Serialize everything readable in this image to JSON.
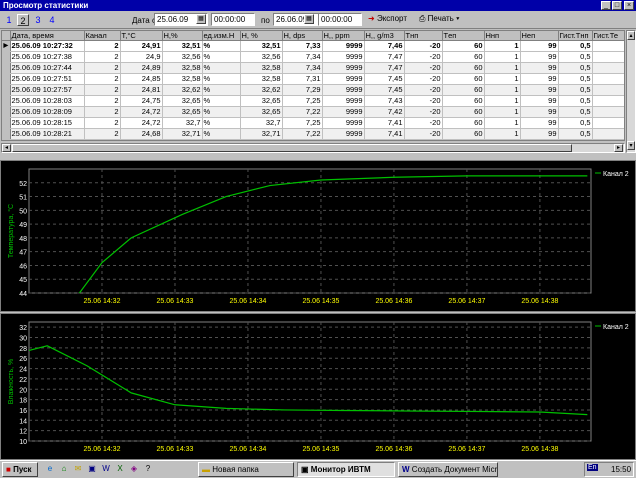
{
  "window": {
    "title": "Просмотр статистики",
    "min": "_",
    "max": "□",
    "close": "×"
  },
  "toolbar": {
    "pages": [
      "1",
      "2",
      "3",
      "4"
    ],
    "date_from_label": "Дата с",
    "date_from": "25.06.09",
    "time_from": "00:00:00",
    "to_label": "по",
    "date_to": "26.06.09",
    "time_to": "00:00:00",
    "export_label": "Экспорт",
    "print_label": "Печать",
    "print_arrow": "▾"
  },
  "table": {
    "headers": [
      "Дата, время",
      "Канал",
      "T,°C",
      "H,%",
      "ед.изм.H",
      "H, %",
      "H, dps",
      "H,, ppm",
      "H,, g/m3",
      "Tнп",
      "Tеп",
      "Hнп",
      "Hеп",
      "Гист.Tнп",
      "Гист.Те"
    ],
    "rows": [
      [
        "25.06.09 10:27:32",
        "2",
        "24,91",
        "32,51",
        "%",
        "32,51",
        "7,33",
        "9999",
        "7,46",
        "-20",
        "60",
        "1",
        "99",
        "0,5",
        ""
      ],
      [
        "25.06.09 10:27:38",
        "2",
        "24,9",
        "32,56",
        "%",
        "32,56",
        "7,34",
        "9999",
        "7,47",
        "-20",
        "60",
        "1",
        "99",
        "0,5",
        ""
      ],
      [
        "25.06.09 10:27:44",
        "2",
        "24,89",
        "32,58",
        "%",
        "32,58",
        "7,34",
        "9999",
        "7,47",
        "-20",
        "60",
        "1",
        "99",
        "0,5",
        ""
      ],
      [
        "25.06.09 10:27:51",
        "2",
        "24,85",
        "32,58",
        "%",
        "32,58",
        "7,31",
        "9999",
        "7,45",
        "-20",
        "60",
        "1",
        "99",
        "0,5",
        ""
      ],
      [
        "25.06.09 10:27:57",
        "2",
        "24,81",
        "32,62",
        "%",
        "32,62",
        "7,29",
        "9999",
        "7,45",
        "-20",
        "60",
        "1",
        "99",
        "0,5",
        ""
      ],
      [
        "25.06.09 10:28:03",
        "2",
        "24,75",
        "32,65",
        "%",
        "32,65",
        "7,25",
        "9999",
        "7,43",
        "-20",
        "60",
        "1",
        "99",
        "0,5",
        ""
      ],
      [
        "25.06.09 10:28:09",
        "2",
        "24,72",
        "32,65",
        "%",
        "32,65",
        "7,22",
        "9999",
        "7,42",
        "-20",
        "60",
        "1",
        "99",
        "0,5",
        ""
      ],
      [
        "25.06.09 10:28:15",
        "2",
        "24,72",
        "32,7",
        "%",
        "32,7",
        "7,25",
        "9999",
        "7,41",
        "-20",
        "60",
        "1",
        "99",
        "0,5",
        ""
      ],
      [
        "25.06.09 10:28:21",
        "2",
        "24,68",
        "32,71",
        "%",
        "32,71",
        "7,22",
        "9999",
        "7,41",
        "-20",
        "60",
        "1",
        "99",
        "0,5",
        ""
      ]
    ]
  },
  "chart_data": [
    {
      "type": "line",
      "ylabel": "Температура, °C",
      "ylim": [
        44,
        53
      ],
      "yticks": [
        44,
        45,
        46,
        47,
        48,
        49,
        50,
        51,
        52
      ],
      "xticks": [
        "25.06 14:32",
        "25.06 14:33",
        "25.06 14:34",
        "25.06 14:35",
        "25.06 14:36",
        "25.06 14:37",
        "25.06 14:38"
      ],
      "xlim": [
        0,
        7.7
      ],
      "grid": true,
      "legend": "top-right",
      "line_color": "#00c000",
      "series": [
        {
          "name": "Канал 2",
          "x": [
            0.25,
            0.55,
            1.0,
            1.4,
            2.1,
            2.7,
            3.3,
            4.0,
            5.0,
            6.0,
            7.0,
            7.65
          ],
          "y": [
            40.5,
            43.0,
            46.2,
            48.0,
            49.7,
            51.0,
            51.8,
            52.2,
            52.4,
            52.5,
            52.5,
            52.5
          ]
        }
      ]
    },
    {
      "type": "line",
      "ylabel": "Влажность, %",
      "ylim": [
        10,
        33
      ],
      "yticks": [
        10,
        12,
        14,
        16,
        18,
        20,
        22,
        24,
        26,
        28,
        30,
        32
      ],
      "xticks": [
        "25.06 14:32",
        "25.06 14:33",
        "25.06 14:34",
        "25.06 14:35",
        "25.06 14:36",
        "25.06 14:37",
        "25.06 14:38"
      ],
      "xlim": [
        0,
        7.7
      ],
      "grid": true,
      "legend": "top-right",
      "line_color": "#00c000",
      "series": [
        {
          "name": "Канал 2",
          "x": [
            0.0,
            0.25,
            0.8,
            1.4,
            2.0,
            2.7,
            3.5,
            4.3,
            5.2,
            6.2,
            7.0,
            7.65
          ],
          "y": [
            27.5,
            28.4,
            24.5,
            19.3,
            17.0,
            16.3,
            16.0,
            15.9,
            15.8,
            15.7,
            15.6,
            15.1
          ]
        }
      ]
    }
  ],
  "taskbar": {
    "start": "Пуск",
    "quick": [
      "e",
      "⌂",
      "✉",
      "▣",
      "W",
      "X",
      "◈",
      "?"
    ],
    "tasks": [
      "Новая папка",
      "Монитор ИВТМ",
      "Создать Документ Micros..."
    ],
    "lang": "En",
    "time": "15:50"
  }
}
